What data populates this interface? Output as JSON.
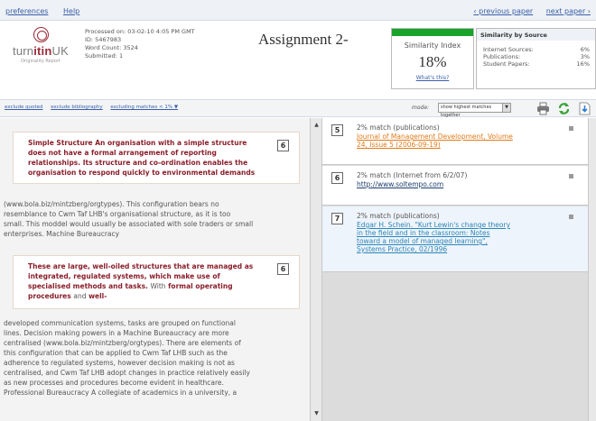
{
  "topnav": {
    "preferences": "preferences",
    "help": "Help",
    "prev_paper": "‹ previous paper",
    "next_paper": "next paper ›"
  },
  "logo": {
    "brand_pre": "turn",
    "brand_mid": "itin",
    "brand_post": "UK",
    "tagline": "Originality Report"
  },
  "meta": {
    "processed": "Processed on: 03-02-10 4:05 PM GMT",
    "id": "ID: 5467983",
    "word_count": "Word Count: 3524",
    "submitted": "Submitted: 1"
  },
  "title": "Assignment 2-",
  "similarity": {
    "label": "Similarity Index",
    "percent": "18%",
    "percent_value": 18,
    "whats_this": "What's this?",
    "bar_color": "#19a32a"
  },
  "sources": {
    "title": "Similarity by Source",
    "rows": [
      {
        "label": "Internet Sources:",
        "value": "6%"
      },
      {
        "label": "Publications:",
        "value": "3%"
      },
      {
        "label": "Student Papers:",
        "value": "16%"
      }
    ]
  },
  "toolbar": {
    "exclude_quoted": "exclude quoted",
    "exclude_bibliography": "exclude bibliography",
    "excluding_matches": "excluding matches < 1% ▼",
    "mode_label": "mode:",
    "mode_value": "show highest matches together",
    "icons": [
      "print-icon",
      "refresh-icon",
      "download-icon"
    ]
  },
  "document": {
    "highlight1": {
      "number": "6",
      "lines": [
        "Simple Structure An organisation with a simple structure",
        "does not have a formal arrangement of reporting",
        "relationships. Its structure and co-ordination enables the",
        "organisation to respond quickly to environmental demands"
      ]
    },
    "para1": [
      "(www.bola.biz/mintzberg/orgtypes). This configuration bears no",
      "resemblance to Cwm Taf LHB's organisational structure, as it is too",
      "small. This moddel would usually be associated with sole traders or small",
      "enterprises. Machine Bureaucracy"
    ],
    "highlight2": {
      "number": "6",
      "lines": [
        "These are large, well-oiled structures that are managed as",
        "integrated, regulated systems, which make use of",
        "specialised methods and tasks.",
        "procedures"
      ],
      "with_word": "With",
      "formal_operating": "formal operating",
      "and_word": "and",
      "well_word": "well-"
    },
    "para2": [
      "developed communication systems, tasks are grouped on functional",
      "lines. Decision making powers in a Machine Bureaucracy are more",
      "centralised (www.bola.biz/mintzberg/orgtypes). There are elements of",
      "this configuration that can be applied to Cwm Taf LHB such as the",
      "adherence to regulated systems, however decision making is not as",
      "centralised, and Cwm Taf LHB adopt changes in practice relatively easily",
      "as new processes and procedures become evident in healthcare.",
      "Professional Bureaucracy A collegiate of academics in a university, a"
    ]
  },
  "matches": [
    {
      "number": "5",
      "head": "2% match (publications)",
      "source": [
        "Journal of Management Development, Volume",
        "24, Issue 5 (2006-09-19)"
      ]
    },
    {
      "number": "6",
      "head": "2% match (Internet from 6/2/07)",
      "source": [
        "http://www.soltempo.com"
      ]
    },
    {
      "number": "7",
      "head": "2% match (publications)",
      "source": [
        "Edgar H. Schein. \"Kurt Lewin's change theory",
        "in the field and in the classroom: Notes",
        "toward a model of managed learning\",",
        "Systems Practice, 02/1996"
      ]
    }
  ]
}
